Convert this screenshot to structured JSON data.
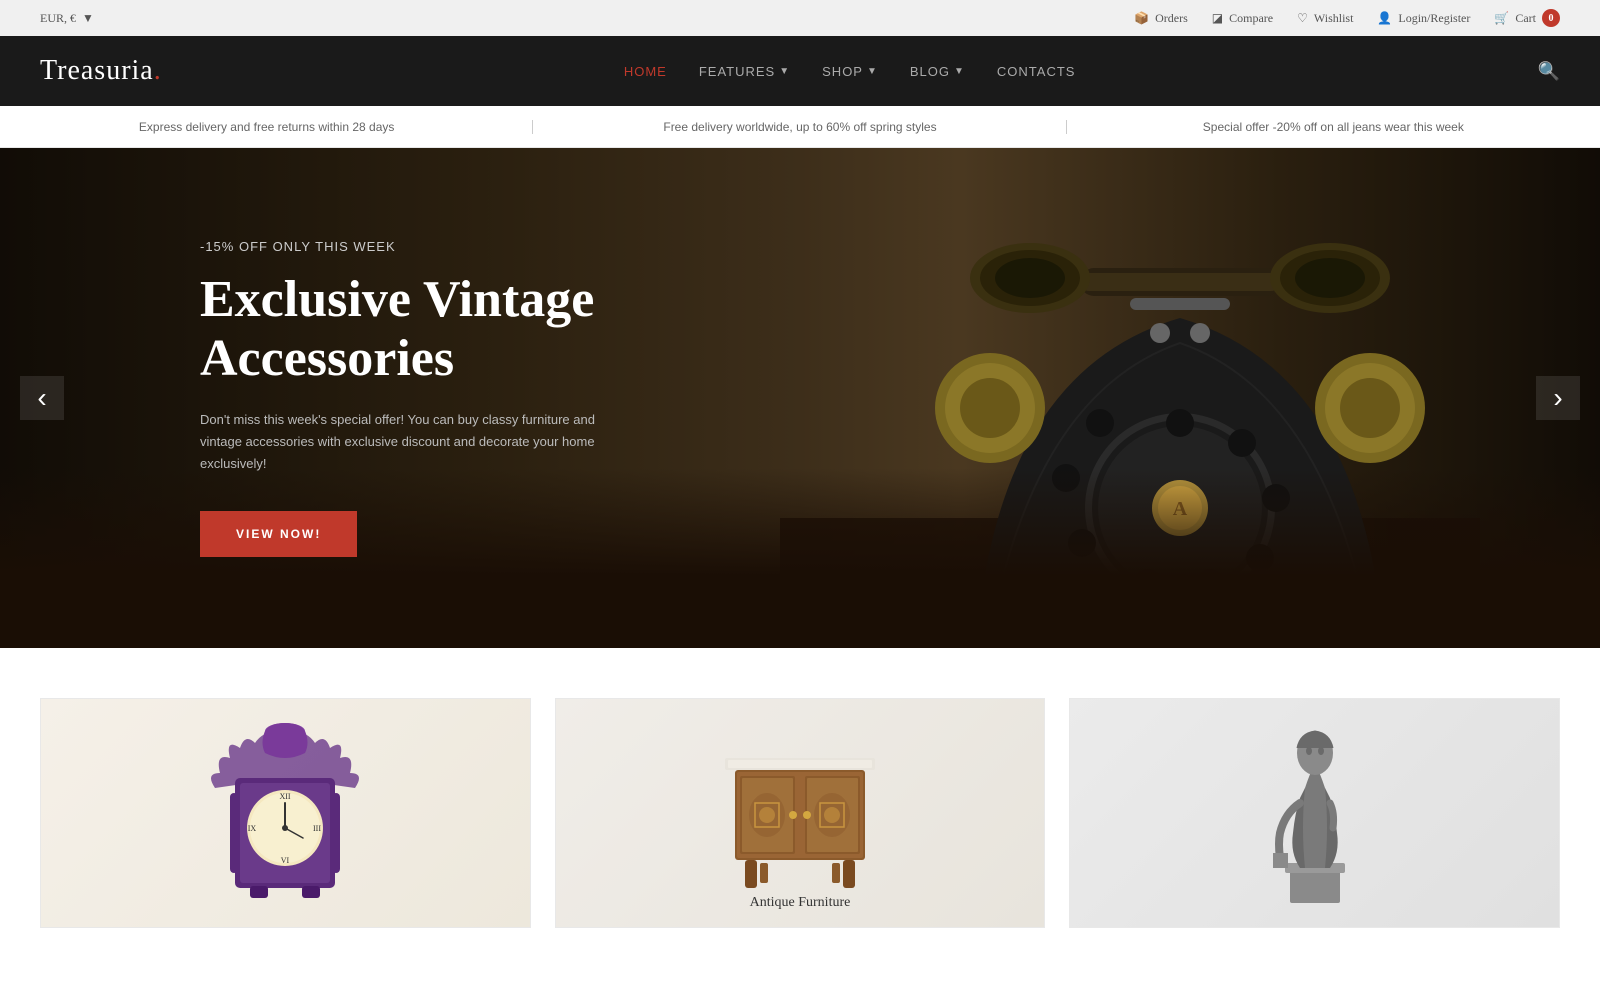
{
  "topbar": {
    "currency": "EUR, €",
    "links": [
      {
        "label": "Orders",
        "icon": "box-icon"
      },
      {
        "label": "Compare",
        "icon": "compare-icon"
      },
      {
        "label": "Wishlist",
        "icon": "heart-icon"
      },
      {
        "label": "Login/Register",
        "icon": "user-icon"
      },
      {
        "label": "Cart",
        "icon": "cart-icon"
      }
    ],
    "cart_count": "0"
  },
  "nav": {
    "logo": "Treasuria.",
    "links": [
      {
        "label": "HOME",
        "active": true,
        "has_dropdown": false
      },
      {
        "label": "FEATURES",
        "active": false,
        "has_dropdown": true
      },
      {
        "label": "SHOP",
        "active": false,
        "has_dropdown": true
      },
      {
        "label": "BLOG",
        "active": false,
        "has_dropdown": true
      },
      {
        "label": "CONTACTS",
        "active": false,
        "has_dropdown": false
      }
    ]
  },
  "promo": {
    "items": [
      "Express delivery and free returns within 28 days",
      "Free delivery worldwide, up to 60% off spring styles",
      "Special offer -20% off on all jeans wear this week"
    ]
  },
  "hero": {
    "subtitle": "-15% OFF ONLY THIS WEEK",
    "title": "Exclusive Vintage\nAccessories",
    "description": "Don't miss this week's special offer! You can buy classy furniture and vintage accessories with exclusive discount and decorate your home exclusively!",
    "button_label": "VIEW NOW!"
  },
  "products": {
    "items": [
      {
        "id": "clock",
        "label": ""
      },
      {
        "id": "furniture",
        "label": "Antique Furniture"
      },
      {
        "id": "statue",
        "label": ""
      }
    ]
  }
}
